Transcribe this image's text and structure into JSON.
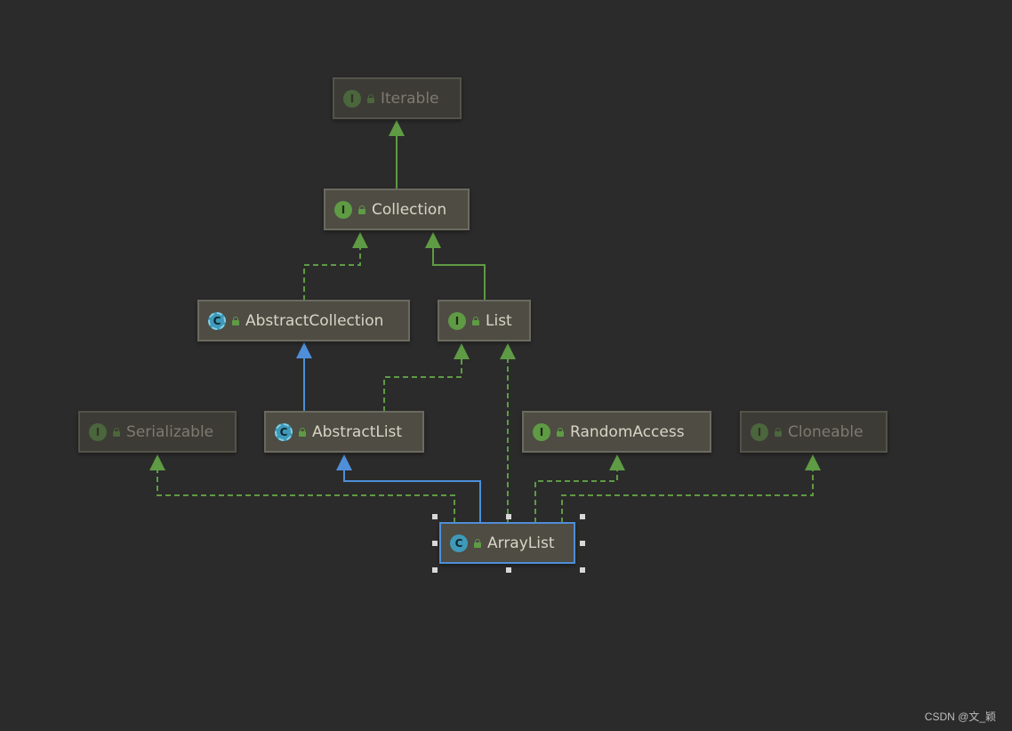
{
  "nodes": {
    "iterable": {
      "name": "Iterable",
      "kind": "I",
      "state": "dim"
    },
    "collection": {
      "name": "Collection",
      "kind": "I",
      "state": "normal"
    },
    "abstract_collection": {
      "name": "AbstractCollection",
      "kind": "C",
      "abstract": true,
      "state": "normal"
    },
    "list": {
      "name": "List",
      "kind": "I",
      "state": "normal"
    },
    "serializable": {
      "name": "Serializable",
      "kind": "I",
      "state": "dim"
    },
    "abstract_list": {
      "name": "AbstractList",
      "kind": "C",
      "abstract": true,
      "state": "normal"
    },
    "random_access": {
      "name": "RandomAccess",
      "kind": "I",
      "state": "normal"
    },
    "cloneable": {
      "name": "Cloneable",
      "kind": "I",
      "state": "dim"
    },
    "array_list": {
      "name": "ArrayList",
      "kind": "C",
      "state": "selected"
    }
  },
  "edges": [
    {
      "from": "Collection",
      "to": "Iterable",
      "type": "extends",
      "style": "solid"
    },
    {
      "from": "AbstractCollection",
      "to": "Collection",
      "type": "implements",
      "style": "dashed"
    },
    {
      "from": "List",
      "to": "Collection",
      "type": "extends",
      "style": "solid"
    },
    {
      "from": "AbstractList",
      "to": "AbstractCollection",
      "type": "extends",
      "style": "solid-blue"
    },
    {
      "from": "AbstractList",
      "to": "List",
      "type": "implements",
      "style": "dashed"
    },
    {
      "from": "ArrayList",
      "to": "AbstractList",
      "type": "extends",
      "style": "solid-blue"
    },
    {
      "from": "ArrayList",
      "to": "List",
      "type": "implements",
      "style": "dashed"
    },
    {
      "from": "ArrayList",
      "to": "Serializable",
      "type": "implements",
      "style": "dashed"
    },
    {
      "from": "ArrayList",
      "to": "RandomAccess",
      "type": "implements",
      "style": "dashed"
    },
    {
      "from": "ArrayList",
      "to": "Cloneable",
      "type": "implements",
      "style": "dashed"
    }
  ],
  "colors": {
    "background": "#2b2b2b",
    "implements_edge": "#5f9b44",
    "extends_class_edge": "#4f8ed8",
    "interface_badge": "#5f9b44",
    "class_badge": "#3f99b8"
  },
  "watermark": "CSDN @文_颖"
}
